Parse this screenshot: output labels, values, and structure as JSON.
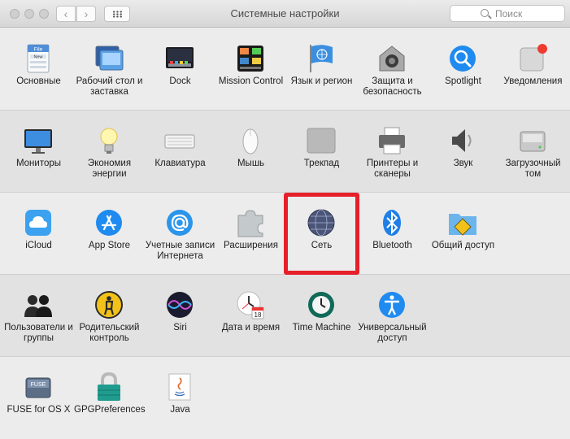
{
  "window": {
    "title": "Системные настройки",
    "search_placeholder": "Поиск"
  },
  "rows": [
    [
      {
        "label": "Основные",
        "icon": "general-icon"
      },
      {
        "label": "Рабочий стол и заставка",
        "icon": "desktop-screensaver-icon"
      },
      {
        "label": "Dock",
        "icon": "dock-icon"
      },
      {
        "label": "Mission Control",
        "icon": "mission-control-icon"
      },
      {
        "label": "Язык и регион",
        "icon": "language-region-icon"
      },
      {
        "label": "Защита и безопасность",
        "icon": "security-icon"
      },
      {
        "label": "Spotlight",
        "icon": "spotlight-icon"
      },
      {
        "label": "Уведомления",
        "icon": "notifications-icon"
      }
    ],
    [
      {
        "label": "Мониторы",
        "icon": "displays-icon"
      },
      {
        "label": "Экономия энергии",
        "icon": "energy-saver-icon"
      },
      {
        "label": "Клавиатура",
        "icon": "keyboard-icon"
      },
      {
        "label": "Мышь",
        "icon": "mouse-icon"
      },
      {
        "label": "Трекпад",
        "icon": "trackpad-icon"
      },
      {
        "label": "Принтеры и сканеры",
        "icon": "printer-icon"
      },
      {
        "label": "Звук",
        "icon": "sound-icon"
      },
      {
        "label": "Загрузочный том",
        "icon": "startup-disk-icon"
      }
    ],
    [
      {
        "label": "iCloud",
        "icon": "icloud-icon"
      },
      {
        "label": "App Store",
        "icon": "app-store-icon"
      },
      {
        "label": "Учетные записи Интернета",
        "icon": "internet-accounts-icon"
      },
      {
        "label": "Расширения",
        "icon": "extensions-icon"
      },
      {
        "label": "Сеть",
        "icon": "network-icon"
      },
      {
        "label": "Bluetooth",
        "icon": "bluetooth-icon"
      },
      {
        "label": "Общий доступ",
        "icon": "sharing-icon"
      }
    ],
    [
      {
        "label": "Пользователи и группы",
        "icon": "users-groups-icon"
      },
      {
        "label": "Родительский контроль",
        "icon": "parental-controls-icon"
      },
      {
        "label": "Siri",
        "icon": "siri-icon"
      },
      {
        "label": "Дата и время",
        "icon": "date-time-icon"
      },
      {
        "label": "Time Machine",
        "icon": "time-machine-icon"
      },
      {
        "label": "Универсальный доступ",
        "icon": "accessibility-icon"
      }
    ],
    [
      {
        "label": "FUSE for OS X",
        "icon": "fuse-icon"
      },
      {
        "label": "GPGPreferences",
        "icon": "gpg-lock-icon"
      },
      {
        "label": "Java",
        "icon": "java-icon"
      }
    ]
  ],
  "icon_text": {
    "fuse": "FUSE",
    "calendar_day": "18",
    "file_badge": "File",
    "new_badge": "New"
  },
  "accent": {
    "highlight": "#e6202a",
    "blue": "#1f8bf0"
  }
}
